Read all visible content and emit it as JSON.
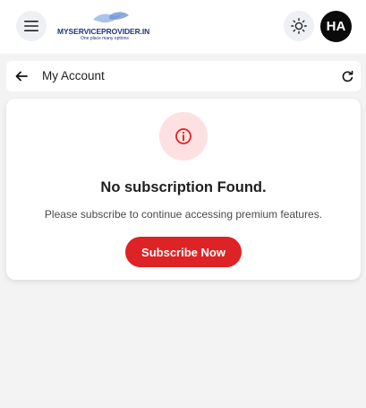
{
  "topbar": {
    "menu_icon": "hamburger-menu-icon",
    "logo": {
      "text": "MYSERVICEPROVIDER.IN",
      "tagline": "One place many options"
    },
    "theme_icon": "sun-icon",
    "avatar_initials": "HA"
  },
  "page_header": {
    "back_icon": "arrow-left-icon",
    "title": "My Account",
    "refresh_icon": "refresh-icon"
  },
  "empty_state": {
    "icon": "info-icon",
    "title": "No subscription Found.",
    "description": "Please subscribe to continue accessing premium features.",
    "button_label": "Subscribe Now"
  },
  "colors": {
    "accent": "#dd2326",
    "icon_bg": "#fde1e1",
    "logo_blue": "#21347c",
    "page_bg": "#f3f3f4"
  }
}
